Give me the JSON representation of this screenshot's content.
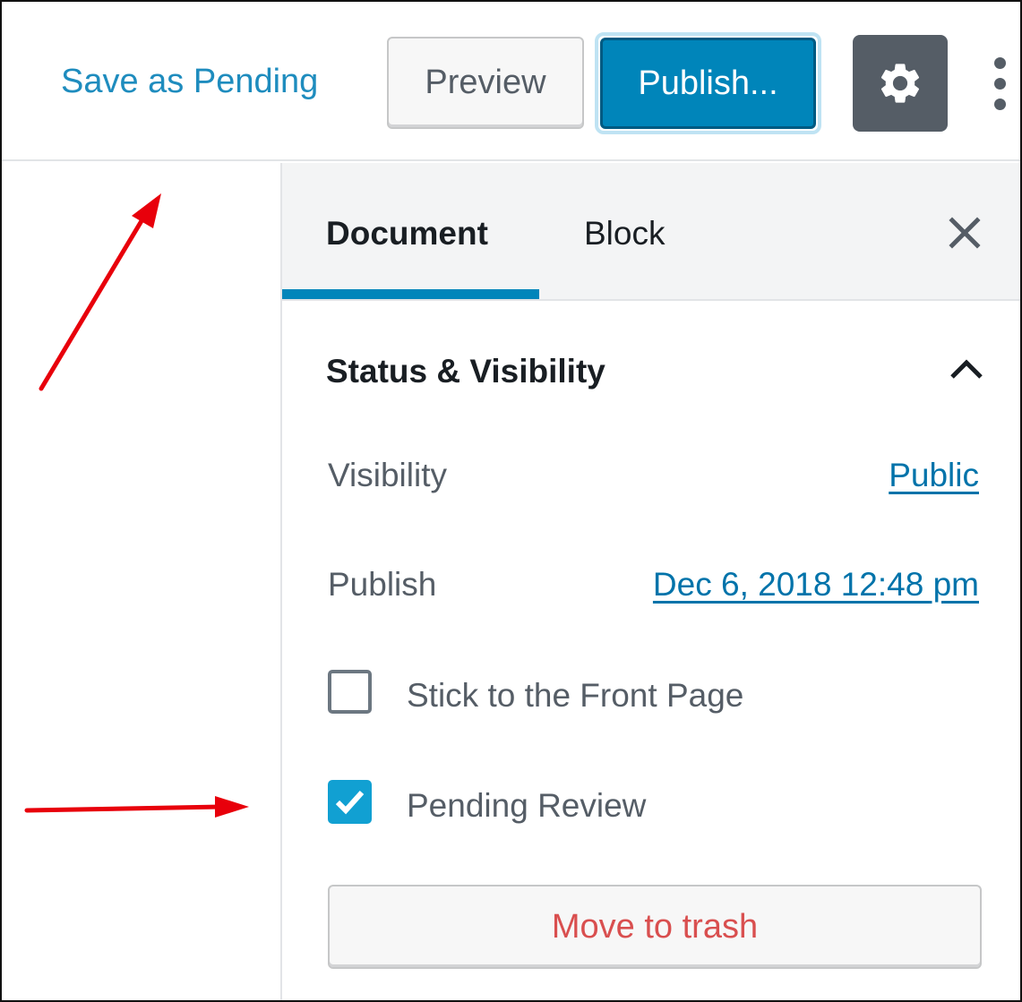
{
  "header": {
    "save_label": "Save as Pending",
    "preview_label": "Preview",
    "publish_label": "Publish...",
    "settings_icon": "gear-icon",
    "more_icon": "kebab-icon"
  },
  "sidebar": {
    "tabs": [
      {
        "label": "Document",
        "active": true
      },
      {
        "label": "Block",
        "active": false
      }
    ],
    "close_icon": "close-icon",
    "panel": {
      "title": "Status & Visibility",
      "expanded": true,
      "visibility_label": "Visibility",
      "visibility_value": "Public",
      "publish_label": "Publish",
      "publish_value": "Dec 6, 2018 12:48 pm",
      "sticky_label": "Stick to the Front Page",
      "sticky_checked": false,
      "pending_label": "Pending Review",
      "pending_checked": true,
      "trash_label": "Move to trash"
    }
  },
  "colors": {
    "accent": "#0085ba",
    "link": "#0073aa",
    "checkbox_checked": "#11a0d2",
    "trash_text": "#d94f4f",
    "annotation_arrow": "#e8000b"
  }
}
